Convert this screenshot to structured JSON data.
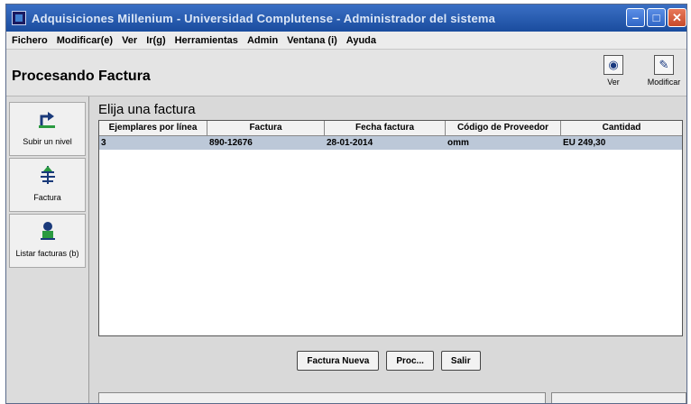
{
  "window": {
    "title": "Adquisiciones Millenium - Universidad Complutense - Administrador del sistema"
  },
  "menu": [
    "Fichero",
    "Modificar(e)",
    "Ver",
    "Ir(g)",
    "Herramientas",
    "Admin",
    "Ventana (i)",
    "Ayuda"
  ],
  "header": {
    "title": "Procesando Factura",
    "tools": [
      {
        "label": "Ver",
        "icon": "view-icon"
      },
      {
        "label": "Modificar",
        "icon": "edit-icon"
      }
    ]
  },
  "sidebar": {
    "items": [
      {
        "label": "Subir un nivel",
        "icon": "up-level-icon"
      },
      {
        "label": "Factura",
        "icon": "invoice-icon"
      },
      {
        "label": "Listar facturas (b)",
        "icon": "list-invoices-icon"
      }
    ]
  },
  "main": {
    "list_title": "Elija una factura",
    "columns": [
      "Ejemplares por línea",
      "Factura",
      "Fecha factura",
      "Código de Proveedor",
      "Cantidad"
    ],
    "rows": [
      [
        "3",
        "890-12676",
        "28-01-2014",
        "omm",
        "EU 249,30"
      ]
    ],
    "buttons": {
      "new": "Factura Nueva",
      "proc": "Proc...",
      "exit": "Salir"
    }
  },
  "colors": {
    "titlebar": "#2a5cb0",
    "selected_row": "#bcc8d8",
    "accent": "#1a4c9e"
  }
}
